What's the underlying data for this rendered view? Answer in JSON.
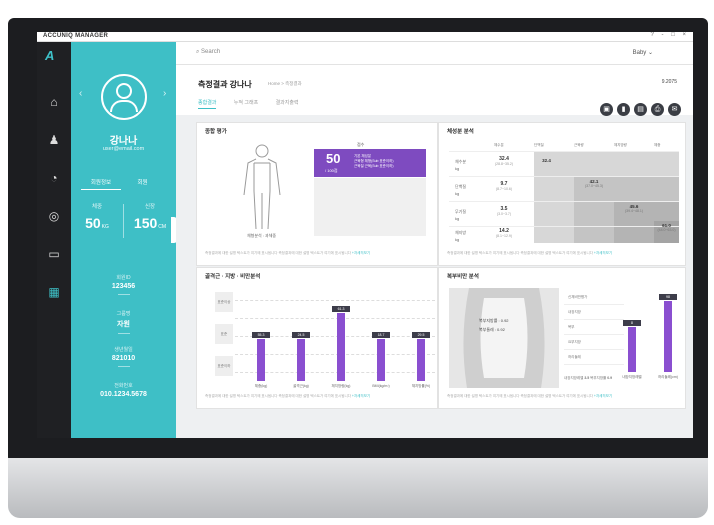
{
  "app": {
    "brand": "ACCUNIQ MANAGER",
    "window_controls": "? - □ ×"
  },
  "profile": {
    "name": "강나나",
    "email": "user@email.com",
    "tabs": [
      "회원정보",
      "회원"
    ],
    "stats": [
      {
        "label": "체중",
        "value": "50",
        "unit": "KG"
      },
      {
        "label": "신장",
        "value": "150",
        "unit": "CM"
      }
    ],
    "info": [
      {
        "label": "회원ID",
        "value": "123456"
      },
      {
        "label": "그룹명",
        "value": "자원"
      },
      {
        "label": "생년월일",
        "value": "821010"
      },
      {
        "label": "전화번호",
        "value": "010.1234.5678"
      }
    ]
  },
  "topbar": {
    "search_placeholder": "Search",
    "user": "Baby ⌄"
  },
  "page": {
    "title": "측정결과 강나나",
    "breadcrumb": "Home > 측정결과",
    "date": "9.2075",
    "tabs": [
      "종합결과",
      "누적 그래프",
      "결과지출력"
    ]
  },
  "panels": {
    "overall": {
      "title": "종합 평가",
      "score_label": "점수",
      "score": "50",
      "score_sub": "/ 100점",
      "figure_caption": "체형분석 : 과체중",
      "score_lines": [
        "기본 체성분",
        "근육형 체형(Sub 표준이하)",
        "근육질 근육(Sub 표준이하)"
      ]
    },
    "composition": {
      "title": "체성분 분석",
      "columns": [
        "체수분",
        "단백질",
        "근육량",
        "체지방량",
        "체중"
      ],
      "rows": [
        {
          "name": "체수분",
          "unit": "kg",
          "value": "32.4",
          "range": "(28.8~35.2)"
        },
        {
          "name": "단백질",
          "unit": "kg",
          "value": "9.7",
          "range": "(8.7~10.6)"
        },
        {
          "name": "무기질",
          "unit": "kg",
          "value": "3.5",
          "range": "(3.0~3.7)"
        },
        {
          "name": "체지방",
          "unit": "kg",
          "value": "14.2",
          "range": "(8.1~12.9)"
        }
      ],
      "steps": [
        {
          "value": "32.4",
          "range": ""
        },
        {
          "value": "42.1",
          "range": "(37.0~45.3)"
        },
        {
          "value": "45.6",
          "range": "(39.4~48.1)"
        },
        {
          "value": "61.0",
          "range": "(44.0~63.0)"
        }
      ]
    },
    "muscle_fat": {
      "title": "골격근 · 지방 · 비만분석",
      "levels": [
        "표준이하",
        "표준",
        "표준이상"
      ],
      "bars": [
        {
          "category": "체중(kg)",
          "label": "55.3",
          "value": 52
        },
        {
          "category": "골격근(kg)",
          "label": "24.5",
          "value": 52
        },
        {
          "category": "체지방량(kg)",
          "label": "61.3",
          "value": 85
        },
        {
          "category": "BMI(kg/m²)",
          "label": "18.7",
          "value": 52
        },
        {
          "category": "체지방률(%)",
          "label": "29.5",
          "value": 52
        }
      ]
    },
    "waist": {
      "title": "복부비만 분석",
      "info": [
        "복부지방률 : 0.92",
        "복부둘레 : 0.92"
      ],
      "table": [
        "신체비만평가",
        "내장지방",
        "복부",
        "요부지방",
        "허리둘레"
      ],
      "bars": [
        {
          "category": "내장지방레벨",
          "label": "8",
          "value": 60
        },
        {
          "category": "허리둘레(cm)",
          "label": "98",
          "value": 95
        }
      ],
      "bottom_row": [
        "내장지방레벨",
        "3.5",
        "복부지방률",
        "0.9"
      ]
    },
    "footer_note": "측정결과에 대한 설명 텍스트가 여기에 표시됩니다 측정결과에 대한 설명 텍스트가 여기에 표시됩니다",
    "more": "+자세히보기"
  }
}
